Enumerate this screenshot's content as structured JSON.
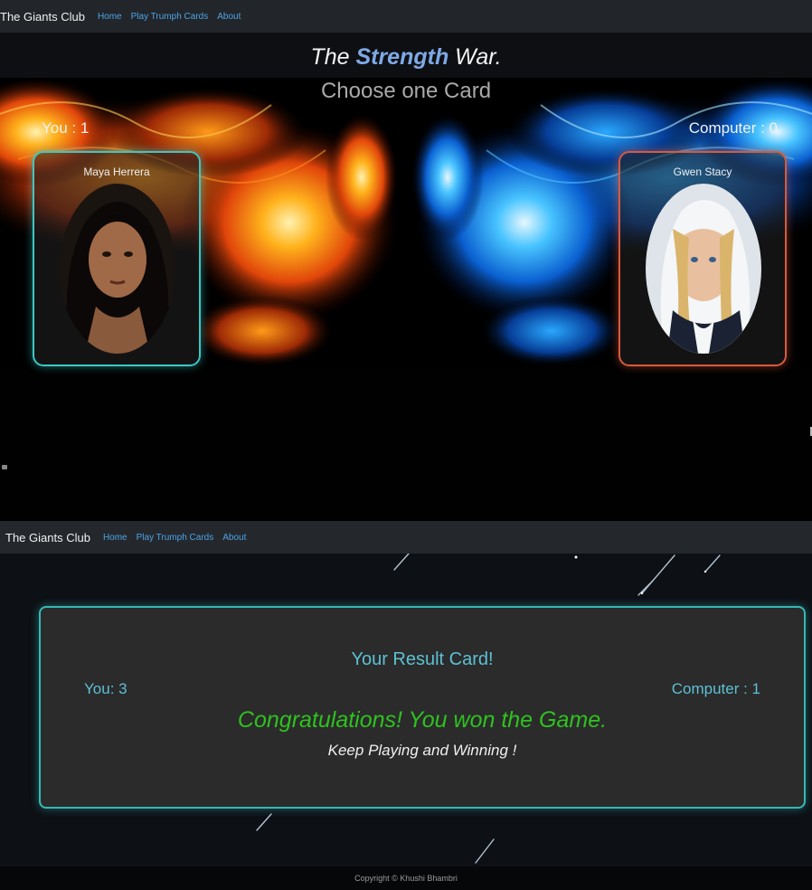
{
  "nav": {
    "brand": "The Giants Club",
    "links": [
      "Home",
      "Play Trumph Cards",
      "About"
    ]
  },
  "game": {
    "title_part1": "The ",
    "title_highlight": "Strength",
    "title_part2": " War.",
    "subtitle": "Choose one Card",
    "player_score": "You : 1",
    "computer_score": "Computer : 0",
    "player_card_name": "Maya Herrera",
    "computer_card_name": "Gwen Stacy"
  },
  "result": {
    "title": "Your Result Card!",
    "you": "You: 3",
    "computer": "Computer : 1",
    "message": "Congratulations! You won the Game.",
    "submessage": "Keep Playing and Winning !"
  },
  "footer": {
    "text": "Copyright © Khushi Bhambri"
  },
  "colors": {
    "player_border": "#3cc7c4",
    "computer_border": "#d85a3c",
    "win_text": "#2ec21f",
    "accent": "#5dc0d4"
  }
}
